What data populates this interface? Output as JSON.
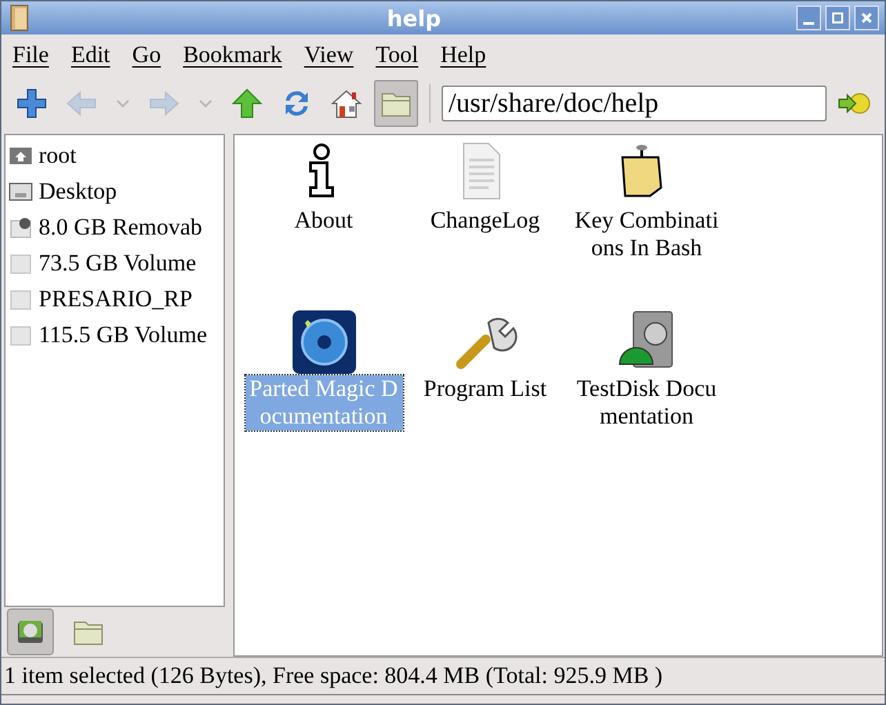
{
  "window": {
    "title": "help"
  },
  "menu": [
    "File",
    "Edit",
    "Go",
    "Bookmark",
    "View",
    "Tool",
    "Help"
  ],
  "toolbar": [
    {
      "kind": "new",
      "disabled": false,
      "selected": false
    },
    {
      "kind": "back",
      "disabled": true,
      "selected": false
    },
    {
      "kind": "dropdown",
      "disabled": true,
      "selected": false
    },
    {
      "kind": "forward",
      "disabled": true,
      "selected": false
    },
    {
      "kind": "dropdown",
      "disabled": true,
      "selected": false
    },
    {
      "kind": "up",
      "disabled": false,
      "selected": false
    },
    {
      "kind": "reload",
      "disabled": false,
      "selected": false
    },
    {
      "kind": "home",
      "disabled": false,
      "selected": false
    },
    {
      "kind": "folder",
      "disabled": false,
      "selected": true
    }
  ],
  "location": {
    "value": "/usr/share/doc/help"
  },
  "sidebar": {
    "items": [
      {
        "kind": "home",
        "label": "root"
      },
      {
        "kind": "desktop",
        "label": "Desktop"
      },
      {
        "kind": "removable",
        "label": "8.0 GB Removab"
      },
      {
        "kind": "volume",
        "label": "73.5 GB Volume"
      },
      {
        "kind": "volume",
        "label": "PRESARIO_RP"
      },
      {
        "kind": "volume",
        "label": "115.5 GB Volume"
      }
    ],
    "tabs": [
      {
        "kind": "places",
        "selected": true
      },
      {
        "kind": "tree",
        "selected": false
      }
    ]
  },
  "files": [
    {
      "kind": "info",
      "label": "About",
      "selected": false
    },
    {
      "kind": "text",
      "label": "ChangeLog",
      "selected": false
    },
    {
      "kind": "note",
      "label": "Key Combinations In Bash",
      "selected": false
    },
    {
      "kind": "disk-app",
      "label": "Parted Magic Documentation",
      "selected": true
    },
    {
      "kind": "wrench",
      "label": "Program List",
      "selected": false
    },
    {
      "kind": "testdisk",
      "label": "TestDisk Documentation",
      "selected": false
    }
  ],
  "status_bar": "1 item selected (126 Bytes), Free space: 804.4 MB (Total: 925.9 MB )"
}
